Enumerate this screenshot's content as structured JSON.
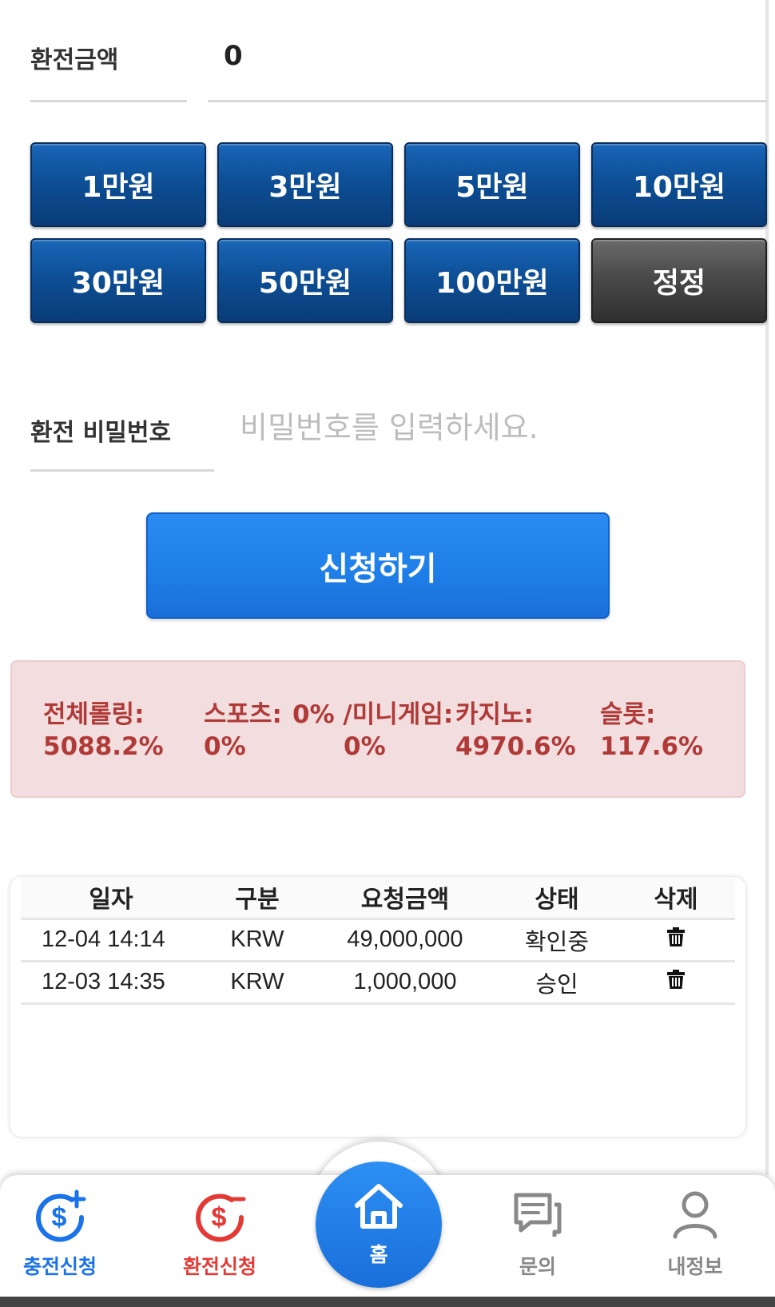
{
  "exchange": {
    "amount_label": "환전금액",
    "amount_value": "0",
    "amount_buttons": [
      "1만원",
      "3만원",
      "5만원",
      "10만원",
      "30만원",
      "50만원",
      "100만원"
    ],
    "reset_button": "정정",
    "password_label": "환전 비밀번호",
    "password_placeholder": "비밀번호를 입력하세요.",
    "submit_button": "신청하기"
  },
  "rolling": {
    "total_label": "전체롤링:",
    "total_value": "5088.2%",
    "sports_label": "스포츠:",
    "sports_value": "0%",
    "mini_label": "0% /미니게임:",
    "mini_value": "0%",
    "casino_label": "카지노:",
    "casino_value": "4970.6%",
    "slot_label": "슬롯:",
    "slot_value": "117.6%"
  },
  "history": {
    "headers": [
      "일자",
      "구분",
      "요청금액",
      "상태",
      "삭제"
    ],
    "rows": [
      {
        "date": "12-04 14:14",
        "type": "KRW",
        "amount": "49,000,000",
        "status": "확인중"
      },
      {
        "date": "12-03 14:35",
        "type": "KRW",
        "amount": "1,000,000",
        "status": "승인"
      }
    ]
  },
  "nav": {
    "deposit": "충전신청",
    "withdraw": "환전신청",
    "home": "홈",
    "inquiry": "문의",
    "myinfo": "내정보"
  },
  "colors": {
    "primary_blue": "#1f7fe8",
    "button_navy": "#0d4f96",
    "active_red": "#e53935",
    "nav_blue": "#1a73e8",
    "rolling_text": "#b03a38",
    "rolling_bg": "#f2dede"
  }
}
